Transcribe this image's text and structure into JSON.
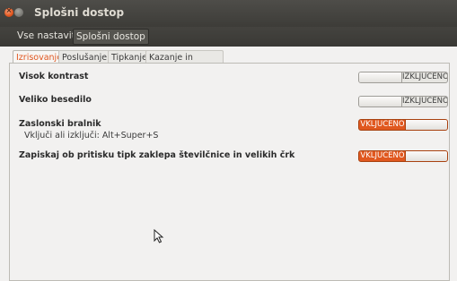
{
  "window": {
    "title": "Splošni dostop",
    "close_glyph": "×"
  },
  "toolbar": {
    "all_settings": "Vse nastavitve",
    "current": "Splošni dostop"
  },
  "tabs": [
    {
      "label": "Izrisovanje",
      "active": true
    },
    {
      "label": "Poslušanje",
      "active": false
    },
    {
      "label": "Tipkanje",
      "active": false
    },
    {
      "label": "Kazanje in klikanje",
      "active": false
    }
  ],
  "settings": [
    {
      "label": "Visok kontrast",
      "state": "off",
      "switch_text": "IZKLJUČENO"
    },
    {
      "label": "Veliko besedilo",
      "state": "off",
      "switch_text": "IZKLJUČENO"
    },
    {
      "label": "Zaslonski bralnik",
      "sublabel": "Vključi ali izključi:  Alt+Super+S",
      "state": "on",
      "switch_text": "VKLJUČENO"
    },
    {
      "label": "Zapiskaj ob pritisku tipk zaklepa številčnice in velikih črk",
      "state": "on",
      "switch_text": "VKLJUČENO"
    }
  ],
  "colors": {
    "accent": "#e0581f",
    "titlebar": "#3d3c38",
    "background": "#f2f1f0"
  }
}
